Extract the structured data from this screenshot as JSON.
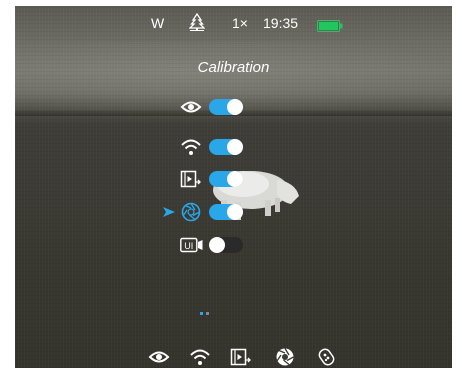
{
  "status_bar": {
    "mode": "W",
    "tree_icon": "tree-icon",
    "zoom": "1×",
    "time": "19:35",
    "battery_icon": "battery-icon",
    "battery_color": "#22c55e"
  },
  "menu": {
    "title": "Calibration",
    "selected_index": 3,
    "items": [
      {
        "icon": "eye-icon",
        "state": "on"
      },
      {
        "icon": "wifi-icon",
        "state": "on"
      },
      {
        "icon": "video-record-icon",
        "state": "on"
      },
      {
        "icon": "shutter-icon",
        "state": "on"
      },
      {
        "icon": "ui-camera-icon",
        "icon_text": "UI",
        "state": "off"
      }
    ]
  },
  "pager": {
    "pages": 2,
    "active": 1
  },
  "bottom_bar": {
    "icons": [
      "eye-icon",
      "wifi-icon",
      "video-record-icon",
      "shutter-icon",
      "remote-icon"
    ]
  },
  "colors": {
    "accent": "#29a7e8",
    "toggle_off": "#2a2a2a",
    "text": "#ffffff"
  }
}
